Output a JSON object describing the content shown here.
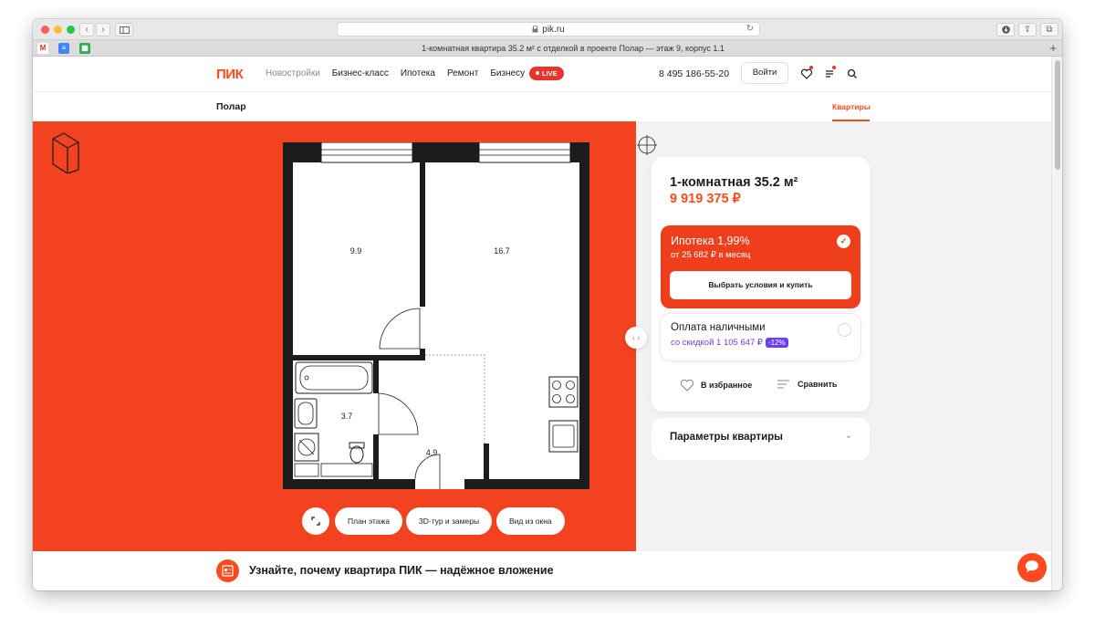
{
  "browser": {
    "url": "pik.ru",
    "tab_title": "1-комнатная квартира 35.2 м² с отделкой в проекте Полар — этаж 9, корпус 1.1",
    "new_tab_label": "+"
  },
  "header": {
    "logo": "ПИК",
    "nav": [
      "Новостройки",
      "Бизнес-класс",
      "Ипотека",
      "Ремонт",
      "Бизнесу"
    ],
    "live_label": "LIVE",
    "phone": "8 495 186-55-20",
    "login_label": "Войти"
  },
  "subheader": {
    "project_name": "Полар",
    "tab_label": "Квартиры"
  },
  "floorplan": {
    "rooms": [
      {
        "area": "9.9"
      },
      {
        "area": "16.7"
      },
      {
        "area": "3.7"
      },
      {
        "area": "4.9"
      }
    ]
  },
  "view_buttons": [
    "План этажа",
    "3D-тур и замеры",
    "Вид из окна"
  ],
  "card": {
    "title": "1-комнатная 35.2 м²",
    "price": "9 919 375 ₽",
    "mortgage": {
      "title": "Ипотека 1,99%",
      "subtitle": "от 25 682 ₽ в месяц",
      "button": "Выбрать условия и купить"
    },
    "cash": {
      "title": "Оплата наличными",
      "subtitle": "со скидкой 1 105 647 ₽",
      "discount": "-12%"
    },
    "favorite_label": "В избранное",
    "compare_label": "Сравнить"
  },
  "params": {
    "title": "Параметры квартиры"
  },
  "promo": {
    "text": "Узнайте, почему квартира ПИК — надёжное вложение"
  },
  "colors": {
    "brand": "#ff4a1f",
    "hero_bg": "#f2421f",
    "discount": "#6b3df5"
  }
}
